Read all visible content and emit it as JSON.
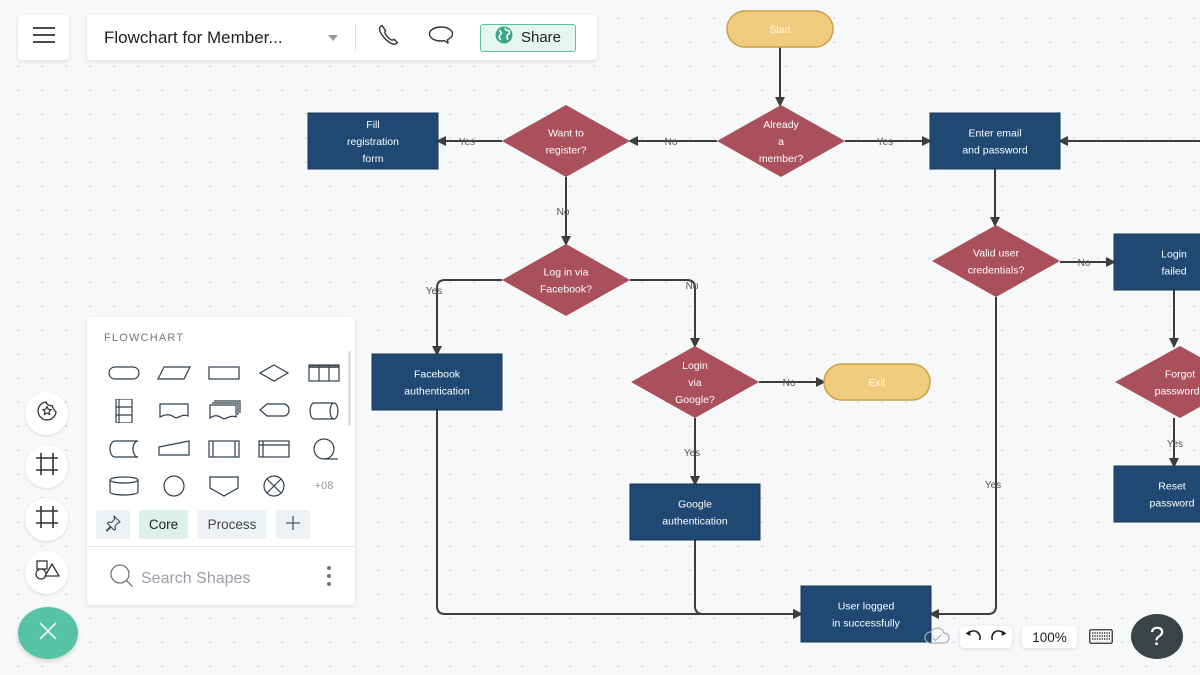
{
  "header": {
    "document_title": "Flowchart for Member...",
    "share_label": "Share",
    "menu_icon": "hamburger-icon",
    "phone_icon": "phone-icon",
    "comment_icon": "comment-icon",
    "share_icon": "globe-icon"
  },
  "colors": {
    "terminal_fill": "#f0cd7e",
    "terminal_stroke": "#c9a043",
    "decision_fill": "#a9505b",
    "process_fill": "#1f4873",
    "connector": "#3d3d3d",
    "accent": "#56c3a2",
    "share_bg": "#e4f6ef"
  },
  "flowchart": {
    "nodes": [
      {
        "id": "start",
        "type": "terminal",
        "lines": [
          "Start"
        ]
      },
      {
        "id": "already-member",
        "type": "decision",
        "lines": [
          "Already",
          "a",
          "member?"
        ]
      },
      {
        "id": "want-register",
        "type": "decision",
        "lines": [
          "Want    to",
          "register?"
        ]
      },
      {
        "id": "fill-registration",
        "type": "process",
        "lines": [
          "Fill",
          "registration",
          "form"
        ]
      },
      {
        "id": "enter-email",
        "type": "process",
        "lines": [
          "Enter    email",
          "and   password"
        ]
      },
      {
        "id": "login-facebook",
        "type": "decision",
        "lines": [
          "Log   in  via",
          "Facebook?"
        ]
      },
      {
        "id": "valid-credentials",
        "type": "decision",
        "lines": [
          "Valid    user",
          "credentials?"
        ]
      },
      {
        "id": "login-failed",
        "type": "process",
        "lines": [
          "Login",
          "failed"
        ]
      },
      {
        "id": "facebook-auth",
        "type": "process",
        "lines": [
          "Facebook",
          "authentication"
        ]
      },
      {
        "id": "login-google",
        "type": "decision",
        "lines": [
          "Login",
          "via",
          "Google?"
        ]
      },
      {
        "id": "exit",
        "type": "terminal",
        "lines": [
          "Exit"
        ]
      },
      {
        "id": "forgot-password",
        "type": "decision",
        "lines": [
          "Forgot",
          "password?"
        ]
      },
      {
        "id": "google-auth",
        "type": "process",
        "lines": [
          "Google",
          "authentication"
        ]
      },
      {
        "id": "reset-password",
        "type": "process",
        "lines": [
          "Reset",
          "password"
        ]
      },
      {
        "id": "logged-in",
        "type": "process",
        "lines": [
          "User    logged",
          "in  successfully"
        ]
      }
    ],
    "edges": [
      {
        "from": "start",
        "to": "already-member",
        "label": ""
      },
      {
        "from": "already-member",
        "to": "want-register",
        "label": "No"
      },
      {
        "from": "already-member",
        "to": "enter-email",
        "label": "Yes"
      },
      {
        "from": "want-register",
        "to": "fill-registration",
        "label": "Yes"
      },
      {
        "from": "want-register",
        "to": "login-facebook",
        "label": "No"
      },
      {
        "from": "login-facebook",
        "to": "facebook-auth",
        "label": "Yes"
      },
      {
        "from": "login-facebook",
        "to": "login-google",
        "label": "No"
      },
      {
        "from": "login-google",
        "to": "exit",
        "label": "No"
      },
      {
        "from": "login-google",
        "to": "google-auth",
        "label": "Yes"
      },
      {
        "from": "enter-email",
        "to": "valid-credentials",
        "label": ""
      },
      {
        "from": "valid-credentials",
        "to": "login-failed",
        "label": "No"
      },
      {
        "from": "valid-credentials",
        "to": "logged-in",
        "label": "Yes"
      },
      {
        "from": "login-failed",
        "to": "forgot-password",
        "label": ""
      },
      {
        "from": "forgot-password",
        "to": "reset-password",
        "label": "Yes"
      },
      {
        "from": "facebook-auth",
        "to": "logged-in",
        "label": ""
      },
      {
        "from": "google-auth",
        "to": "logged-in",
        "label": ""
      },
      {
        "from": "offscreen-right",
        "to": "enter-email",
        "label": ""
      }
    ]
  },
  "shapes_panel": {
    "title": "FLOWCHART",
    "shapes": [
      "terminator",
      "data",
      "process",
      "decision",
      "swimlane-horizontal",
      "swimlane-vertical",
      "document",
      "multi-document",
      "display",
      "direct-data",
      "stored-data",
      "manual-input",
      "predefined-process",
      "internal-storage",
      "sequential-data",
      "database",
      "connector",
      "off-page-connector",
      "summing-junction"
    ],
    "more_count": "+08",
    "tabs": [
      {
        "label": "",
        "icon": "pin-icon",
        "active": false
      },
      {
        "label": "Core",
        "active": true
      },
      {
        "label": "Process",
        "active": false
      },
      {
        "label": "",
        "icon": "plus-icon",
        "active": false
      }
    ],
    "search_placeholder": "Search Shapes"
  },
  "left_toolbar": [
    {
      "name": "sticker-tool",
      "icon": "sticker-star-icon"
    },
    {
      "name": "frame-tool",
      "icon": "frame-icon"
    },
    {
      "name": "grid-tool",
      "icon": "grid-icon"
    },
    {
      "name": "shapes-tool",
      "icon": "shapes-icon"
    }
  ],
  "bottom_bar": {
    "zoom": "100%",
    "help_label": "?",
    "save_status_icon": "cloud-saved-icon"
  }
}
